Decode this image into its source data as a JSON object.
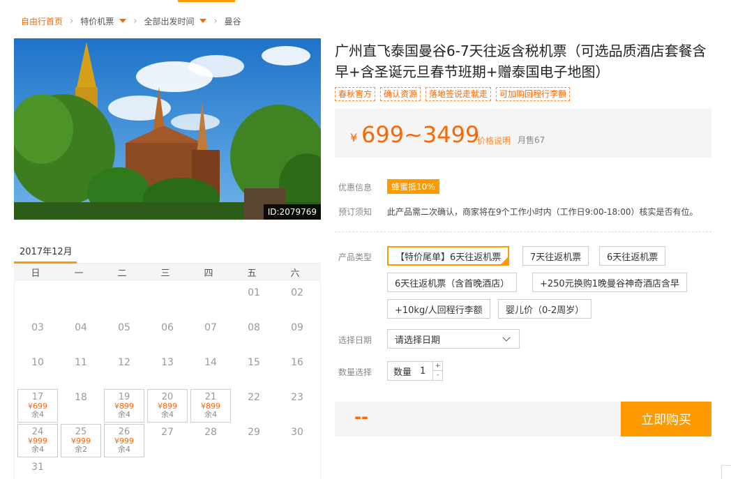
{
  "breadcrumb": {
    "home": "自由行首页",
    "item2": "特价机票",
    "item3": "全部出发时间",
    "item4": "曼谷"
  },
  "photo": {
    "id_label": "ID:2079769"
  },
  "product": {
    "title": "广州直飞泰国曼谷6-7天往返含税机票（可选品质酒店套餐含早+含圣诞元旦春节班期+赠泰国电子地图）",
    "tags": [
      "春秋官方",
      "确认资源",
      "落地签说走就走",
      "可加购回程行李额"
    ]
  },
  "price": {
    "currency": "¥",
    "range": "699~3499",
    "note": "价格说明",
    "sales": "月售67"
  },
  "info": {
    "promo_label": "优惠信息",
    "promo_badge": "蜂蜜抵10%",
    "notice_label": "预订须知",
    "notice_text": "此产品需二次确认，商家将在9个工作小时内（工作日9:00-18:00）核实是否有位。"
  },
  "options": {
    "label": "产品类型",
    "items": [
      "【特价尾单】6天往返机票",
      "7天往返机票",
      "6天往返机票",
      "6天往返机票（含首晚酒店）",
      "+250元换购1晚曼谷神奇酒店含早",
      "+10kg/人回程行李额",
      "婴儿价（0-2周岁）"
    ]
  },
  "date_select": {
    "label": "选择日期",
    "placeholder": "请选择日期"
  },
  "quantity": {
    "label": "数量选择",
    "text": "数量",
    "value": "1",
    "plus": "+",
    "minus": "-"
  },
  "buy": {
    "total": "--",
    "button": "立即购买"
  },
  "calendar": {
    "month": "2017年12月",
    "weekdays": [
      "日",
      "一",
      "二",
      "三",
      "四",
      "五",
      "六"
    ],
    "days": [
      {
        "d": "01"
      },
      {
        "d": "02"
      },
      {
        "d": "03"
      },
      {
        "d": "04"
      },
      {
        "d": "05"
      },
      {
        "d": "06"
      },
      {
        "d": "07"
      },
      {
        "d": "08"
      },
      {
        "d": "09"
      },
      {
        "d": "10"
      },
      {
        "d": "11"
      },
      {
        "d": "12"
      },
      {
        "d": "13"
      },
      {
        "d": "14"
      },
      {
        "d": "15"
      },
      {
        "d": "16"
      },
      {
        "d": "17",
        "price": "¥699",
        "remain": "余4"
      },
      {
        "d": "18"
      },
      {
        "d": "19",
        "price": "¥899",
        "remain": "余4"
      },
      {
        "d": "20",
        "price": "¥899",
        "remain": "余4"
      },
      {
        "d": "21",
        "price": "¥899",
        "remain": "余4"
      },
      {
        "d": "22"
      },
      {
        "d": "23"
      },
      {
        "d": "24",
        "price": "¥999",
        "remain": "余4"
      },
      {
        "d": "25",
        "price": "¥999",
        "remain": "余2"
      },
      {
        "d": "26",
        "price": "¥999",
        "remain": "余4"
      },
      {
        "d": "27"
      },
      {
        "d": "28"
      },
      {
        "d": "29"
      },
      {
        "d": "30"
      },
      {
        "d": "31"
      }
    ]
  },
  "colors": {
    "accent": "#ff9900",
    "price": "#ff6600"
  }
}
